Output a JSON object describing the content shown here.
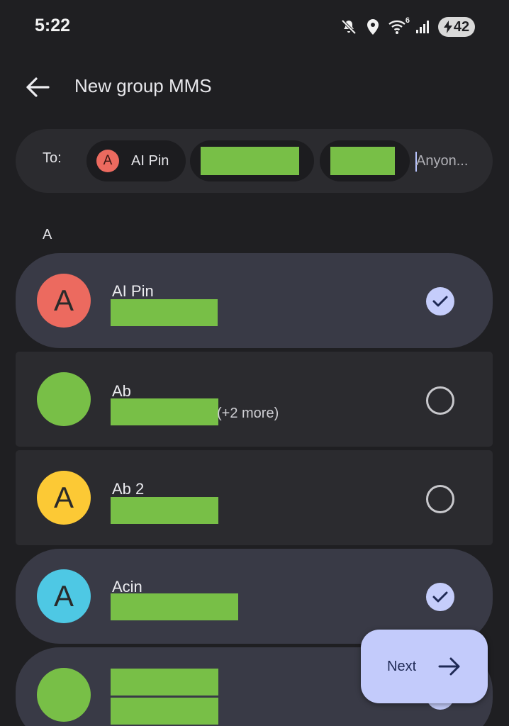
{
  "status_bar": {
    "time": "5:22",
    "battery": "42",
    "wifi_label": "6"
  },
  "header": {
    "title": "New group MMS"
  },
  "to_field": {
    "label": "To:",
    "chips": [
      {
        "initial": "A",
        "label": "AI Pin"
      },
      {
        "label": ""
      },
      {
        "label": ""
      }
    ],
    "placeholder": "Anyon..."
  },
  "section_letter": "A",
  "contacts": [
    {
      "initial": "A",
      "name": "AI Pin",
      "more": "",
      "selected": true,
      "color": "#ec6a5f"
    },
    {
      "initial": "",
      "name": "Ab",
      "more": "(+2 more)",
      "selected": false,
      "color": "#78bf47"
    },
    {
      "initial": "A",
      "name": "Ab 2",
      "more": "",
      "selected": false,
      "color": "#fcc935"
    },
    {
      "initial": "A",
      "name": "Acin",
      "more": "",
      "selected": true,
      "color": "#4ec8e4"
    },
    {
      "initial": "",
      "name": "",
      "more": "",
      "selected": true,
      "color": "#78bf47"
    }
  ],
  "fab": {
    "label": "Next"
  },
  "colors": {
    "background": "#1f1f22",
    "selected_row": "#393a46",
    "unselected_row": "#2b2b2f",
    "accent": "#c3cbfb",
    "redaction": "#78bf47"
  }
}
